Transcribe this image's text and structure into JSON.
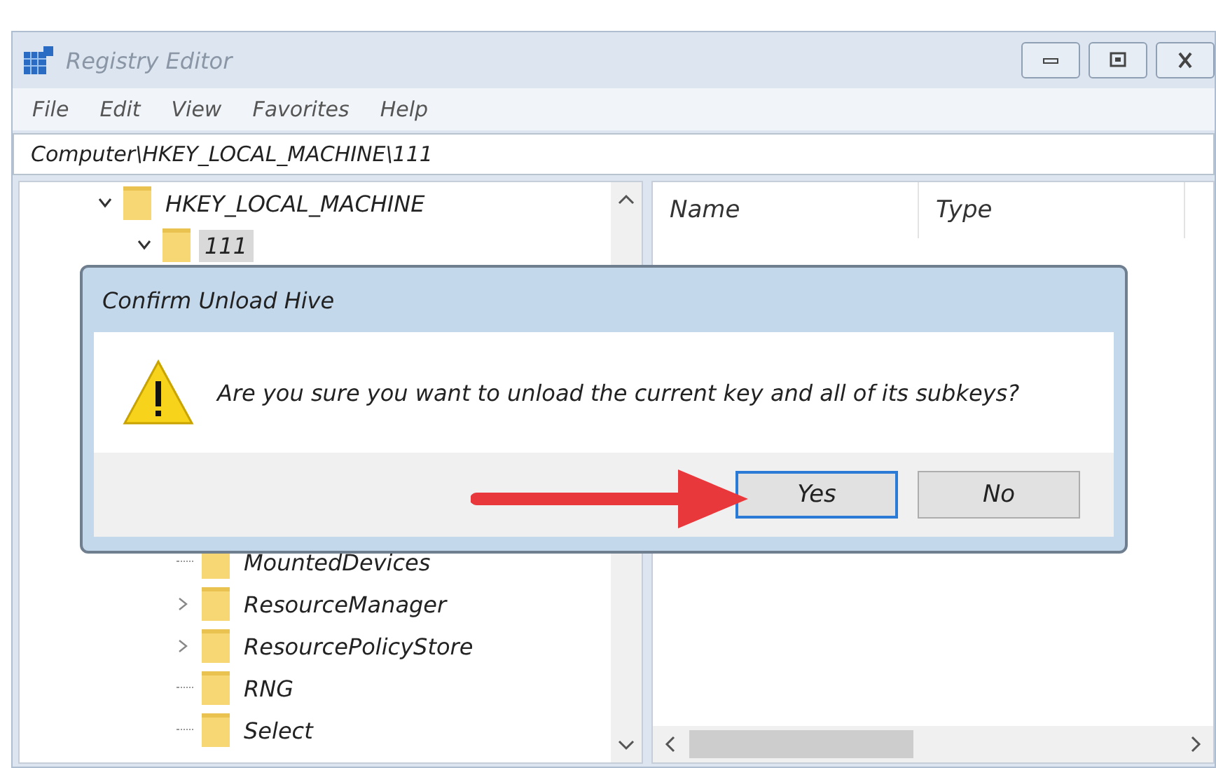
{
  "window": {
    "title": "Registry Editor"
  },
  "menu": [
    "File",
    "Edit",
    "View",
    "Favorites",
    "Help"
  ],
  "address": "Computer\\HKEY_LOCAL_MACHINE\\111",
  "tree": [
    {
      "label": "HKEY_LOCAL_MACHINE",
      "expanded": true,
      "selected": false,
      "children": [
        {
          "label": "111",
          "expanded": true,
          "selected": true,
          "children": [
            {
              "label": "MountedDevices",
              "selected": false
            },
            {
              "label": "ResourceManager",
              "expanded": false,
              "selected": false
            },
            {
              "label": "ResourcePolicyStore",
              "expanded": false,
              "selected": false
            },
            {
              "label": "RNG",
              "selected": false
            },
            {
              "label": "Select",
              "selected": false
            }
          ]
        }
      ]
    }
  ],
  "columns": [
    "Name",
    "Type"
  ],
  "dialog": {
    "title": "Confirm Unload Hive",
    "message": "Are you sure you want to unload the current key and all of its subkeys?",
    "buttons": [
      {
        "label": "Yes",
        "selected": true
      },
      {
        "label": "No",
        "selected": false
      }
    ]
  }
}
